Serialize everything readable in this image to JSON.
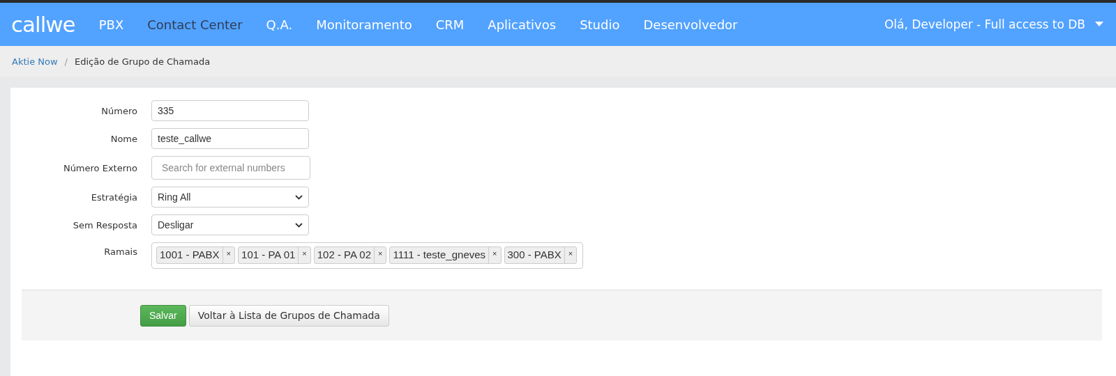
{
  "brand": "callwe",
  "nav": [
    {
      "label": "PBX",
      "selected": false
    },
    {
      "label": "Contact Center",
      "selected": true
    },
    {
      "label": "Q.A.",
      "selected": false
    },
    {
      "label": "Monitoramento",
      "selected": false
    },
    {
      "label": "CRM",
      "selected": false
    },
    {
      "label": "Aplicativos",
      "selected": false
    },
    {
      "label": "Studio",
      "selected": false
    },
    {
      "label": "Desenvolvedor",
      "selected": false
    }
  ],
  "user_menu": "Olá, Developer - Full access to DB",
  "breadcrumb": [
    {
      "label": "Aktie Now",
      "kind": "link"
    },
    {
      "label": "/",
      "kind": "separator"
    },
    {
      "label": "Edição de Grupo de Chamada",
      "kind": "current"
    }
  ],
  "form": [
    {
      "label": "Número",
      "kind": "text",
      "value": "335"
    },
    {
      "label": "Nome",
      "kind": "text",
      "value": "teste_callwe"
    },
    {
      "label": "Número Externo",
      "kind": "search",
      "placeholder": "Search for external numbers"
    },
    {
      "label": "Estratégia",
      "kind": "select",
      "value": "Ring All"
    },
    {
      "label": "Sem Resposta",
      "kind": "select",
      "value": "Desligar"
    },
    {
      "label": "Ramais",
      "kind": "tags",
      "tags": [
        {
          "label": "1001 - PABX",
          "remove": "×"
        },
        {
          "label": "101 - PA 01",
          "remove": "×"
        },
        {
          "label": "102 - PA 02",
          "remove": "×"
        },
        {
          "label": "1111 - teste_gneves",
          "remove": "×"
        },
        {
          "label": "300 - PABX",
          "remove": "×"
        }
      ]
    }
  ],
  "buttons": [
    {
      "label": "Salvar",
      "kind": "primary"
    },
    {
      "label": "Voltar à Lista de Grupos de Chamada",
      "kind": "default"
    }
  ]
}
